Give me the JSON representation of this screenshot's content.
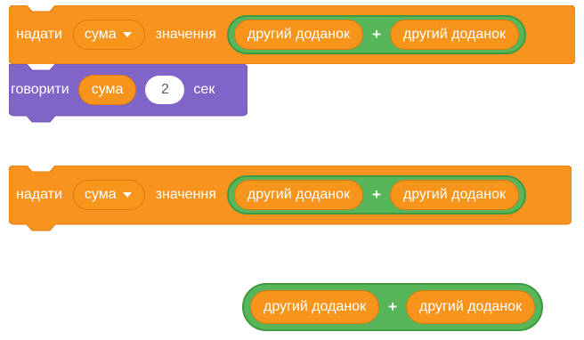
{
  "colors": {
    "motion_orange": "#f7931e",
    "operator_green": "#59c059",
    "looks_purple": "#8064c8",
    "text_white": "#ffffff"
  },
  "blocks": [
    {
      "set_label": "надати",
      "variable": "сума",
      "value_label": "значення",
      "operator": {
        "left": "другий доданок",
        "symbol": "+",
        "right": "другий доданок"
      }
    },
    {
      "say_label": "говорити",
      "variable": "сума",
      "seconds_value": "2",
      "seconds_label": "сек"
    },
    {
      "set_label": "надати",
      "variable": "сума",
      "value_label": "значення",
      "operator": {
        "left": "другий доданок",
        "symbol": "+",
        "right": "другий доданок"
      }
    },
    {
      "operator": {
        "left": "другий доданок",
        "symbol": "+",
        "right": "другий доданок"
      }
    }
  ]
}
